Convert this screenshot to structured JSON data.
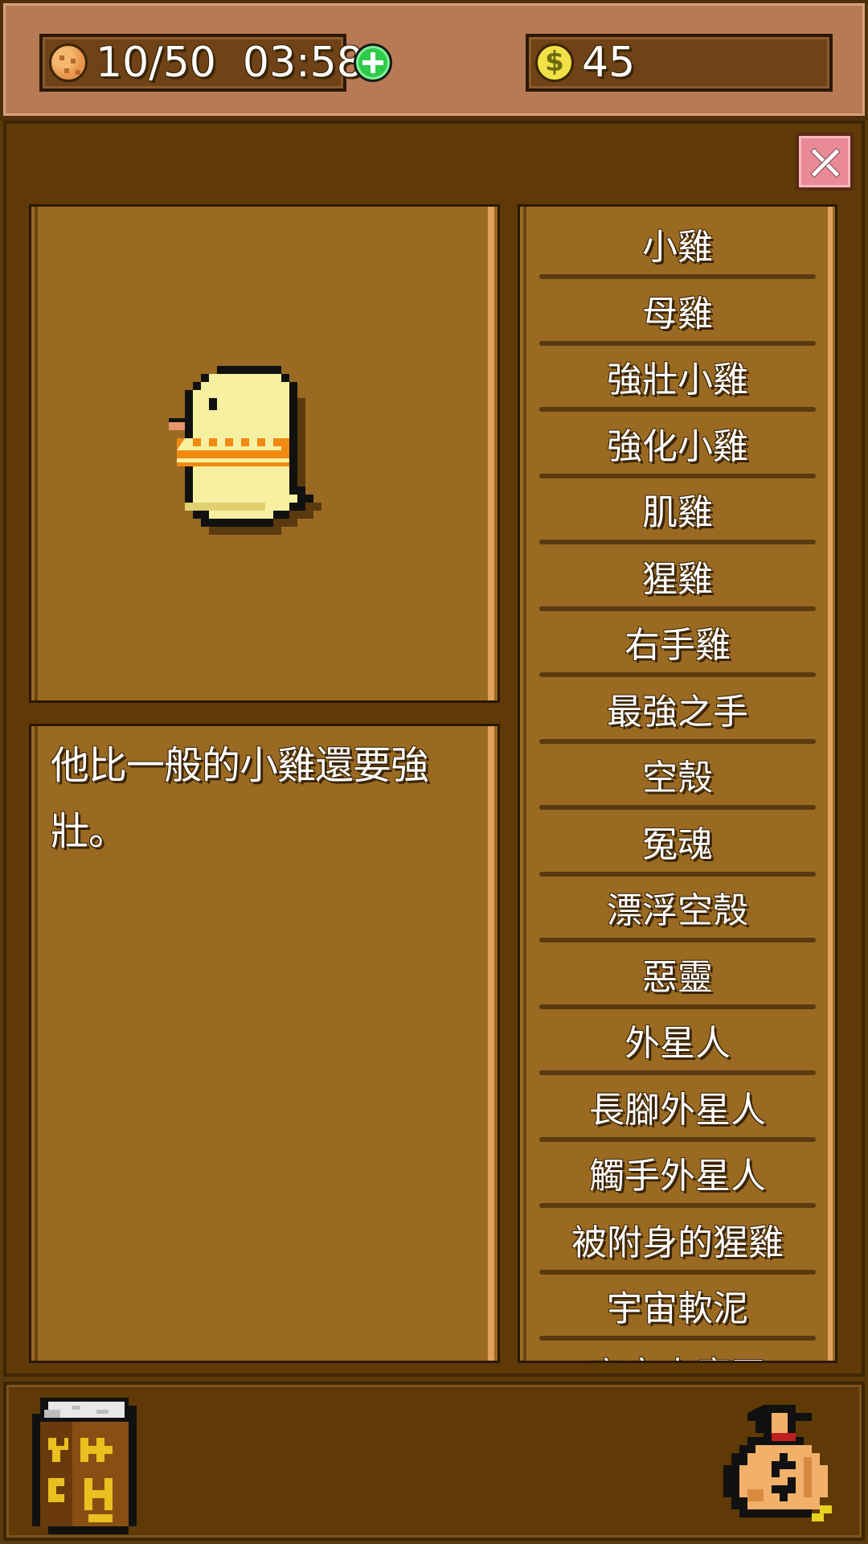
{
  "header": {
    "energy": "10/50",
    "timer": "03:58",
    "coins": "45"
  },
  "icons": {
    "energy": "cookie-icon",
    "add": "plus-icon",
    "coin": "coin-icon",
    "close": "close-icon",
    "book": "book-icon",
    "shop": "money-bag-icon"
  },
  "detail": {
    "description": "他比一般的小雞還要強壯。"
  },
  "monster_list": [
    "小雞",
    "母雞",
    "強壯小雞",
    "強化小雞",
    "肌雞",
    "猩雞",
    "右手雞",
    "最強之手",
    "空殼",
    "冤魂",
    "漂浮空殼",
    "惡靈",
    "外星人",
    "長腳外星人",
    "觸手外星人",
    "被附身的猩雞",
    "宇宙軟泥",
    "宇宙大魔王"
  ],
  "colors": {
    "topbar": "#b87a55",
    "panel": "#9a6a22",
    "background": "#5a3a0a",
    "plus": "#2ecb4a",
    "close": "#e98a96"
  }
}
